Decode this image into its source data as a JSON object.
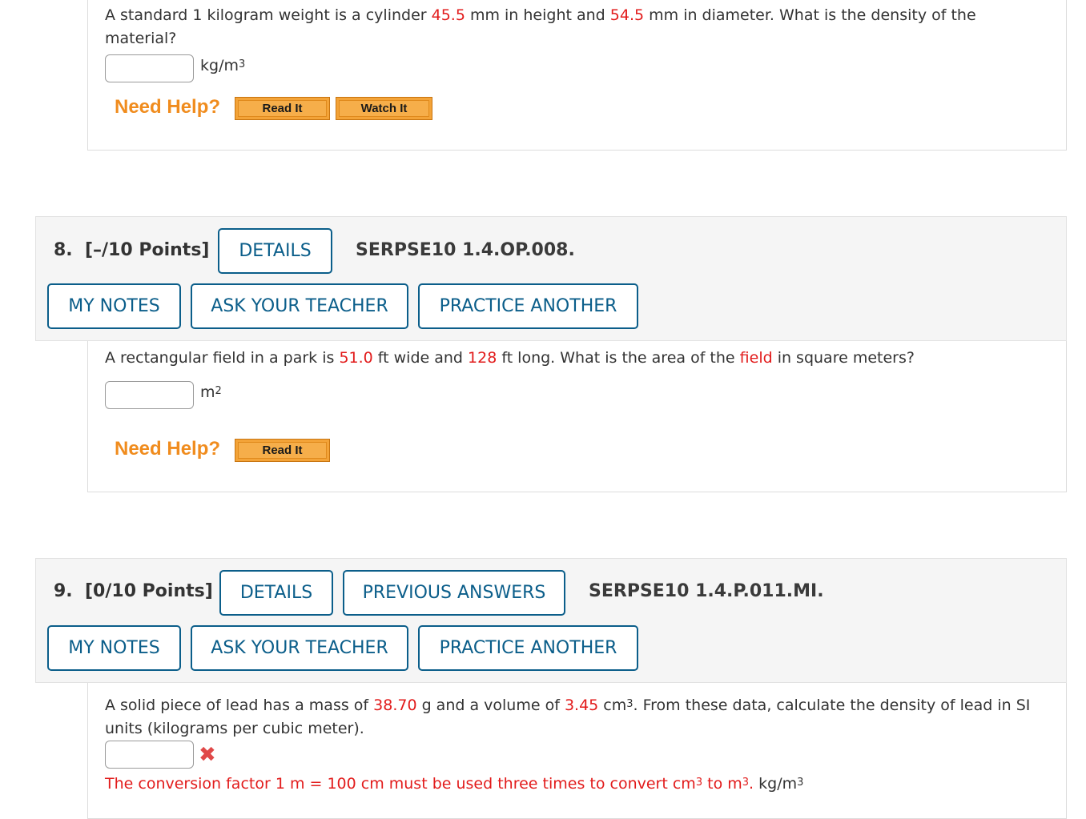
{
  "q7": {
    "text_a": "A standard 1 kilogram weight is a cylinder ",
    "height_value": "45.5",
    "text_b": " mm in height and ",
    "diameter_value": "54.5",
    "text_c": " mm in diameter. What is the density of the material?",
    "unit_base": "kg/m",
    "unit_exp": "3",
    "need_help": "Need Help?",
    "read_it": "Read It",
    "watch_it": "Watch It"
  },
  "q8": {
    "number": "8.",
    "points": "[–/10 Points]",
    "details_label": "DETAILS",
    "code": "SERPSE10 1.4.OP.008.",
    "my_notes_label": "MY NOTES",
    "ask_teacher_label": "ASK YOUR TEACHER",
    "practice_label": "PRACTICE ANOTHER",
    "text_a": "A rectangular field in a park is ",
    "width_value": "51.0",
    "text_b": " ft wide and ",
    "length_value": "128",
    "text_c": " ft long. What is the area of the ",
    "field_word": "field",
    "text_d": " in square meters?",
    "unit_base": "m",
    "unit_exp": "2",
    "need_help": "Need Help?",
    "read_it": "Read It"
  },
  "q9": {
    "number": "9.",
    "points": "[0/10 Points]",
    "details_label": "DETAILS",
    "previous_answers_label": "PREVIOUS ANSWERS",
    "code": "SERPSE10 1.4.P.011.MI.",
    "my_notes_label": "MY NOTES",
    "ask_teacher_label": "ASK YOUR TEACHER",
    "practice_label": "PRACTICE ANOTHER",
    "text_a": "A solid piece of lead has a mass of ",
    "mass_value": "38.70",
    "text_b": " g and a volume of ",
    "volume_value": "3.45",
    "text_c": " cm",
    "cm_exp": "3",
    "text_d": ". From these data, calculate the density of lead in SI units (kilograms per cubic meter).",
    "feedback_a": "The conversion factor 1 m = 100 cm must be used three times to convert cm",
    "feedback_exp1": "3",
    "feedback_b": " to m",
    "feedback_exp2": "3",
    "feedback_c": ".",
    "unit_base": " kg/m",
    "unit_exp": "3",
    "incorrect_mark": "✖"
  }
}
